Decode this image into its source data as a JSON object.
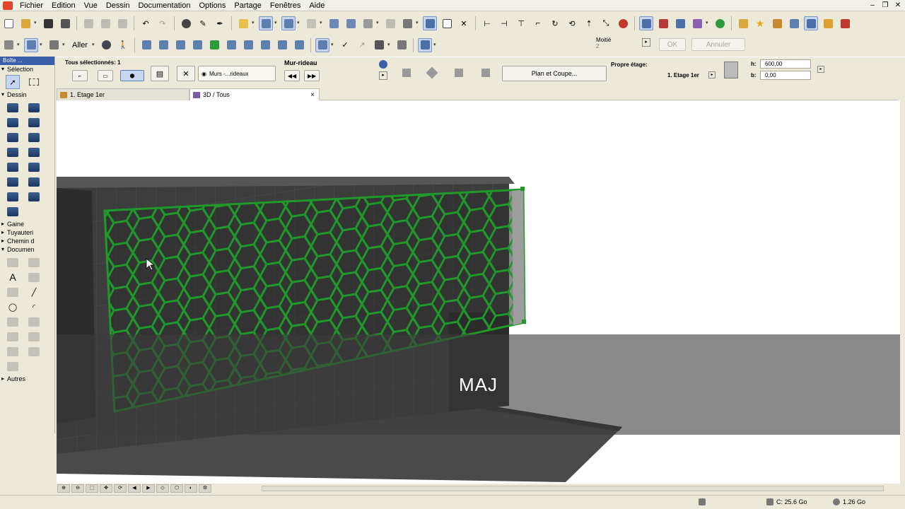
{
  "menu": [
    "Fichier",
    "Edition",
    "Vue",
    "Dessin",
    "Documentation",
    "Options",
    "Partage",
    "Fenêtres",
    "Aide"
  ],
  "toolbar2": {
    "aller_label": "Aller",
    "moitie_label": "Moitié",
    "moitie_value": "2",
    "ok_label": "OK",
    "annuler_label": "Annuler"
  },
  "infobox": {
    "selection_label": "Tous sélectionnés: 1",
    "mur_rideau_label": "Mur-rideau",
    "murs_rideaux_value": "Murs -...rideaux",
    "plan_coupe_label": "Plan et Coupe...",
    "propre_etage_label": "Propre étage:",
    "etage_value": "1. Etage 1er",
    "h_label": "h:",
    "h_value": "600,00",
    "b_label": "b:",
    "b_value": "0,00"
  },
  "toolbox": {
    "title": "Boîte ...",
    "selection_label": "Sélection",
    "dessin_label": "Dessin",
    "groups": [
      "Gaine",
      "Tuyauteri",
      "Chemin d",
      "Documen"
    ],
    "autres_label": "Autres"
  },
  "tabs": [
    {
      "label": "1. Etage 1er",
      "active": false
    },
    {
      "label": "3D / Tous",
      "active": true,
      "close": "×"
    }
  ],
  "overlay_text": "MAJ",
  "status": {
    "disk": "C: 25.6 Go",
    "memory": "1.26 Go"
  },
  "colors": {
    "grid_green": "#1f9a2a",
    "building_dark": "#3a3a3a",
    "overlay": "#3c3c3c"
  }
}
